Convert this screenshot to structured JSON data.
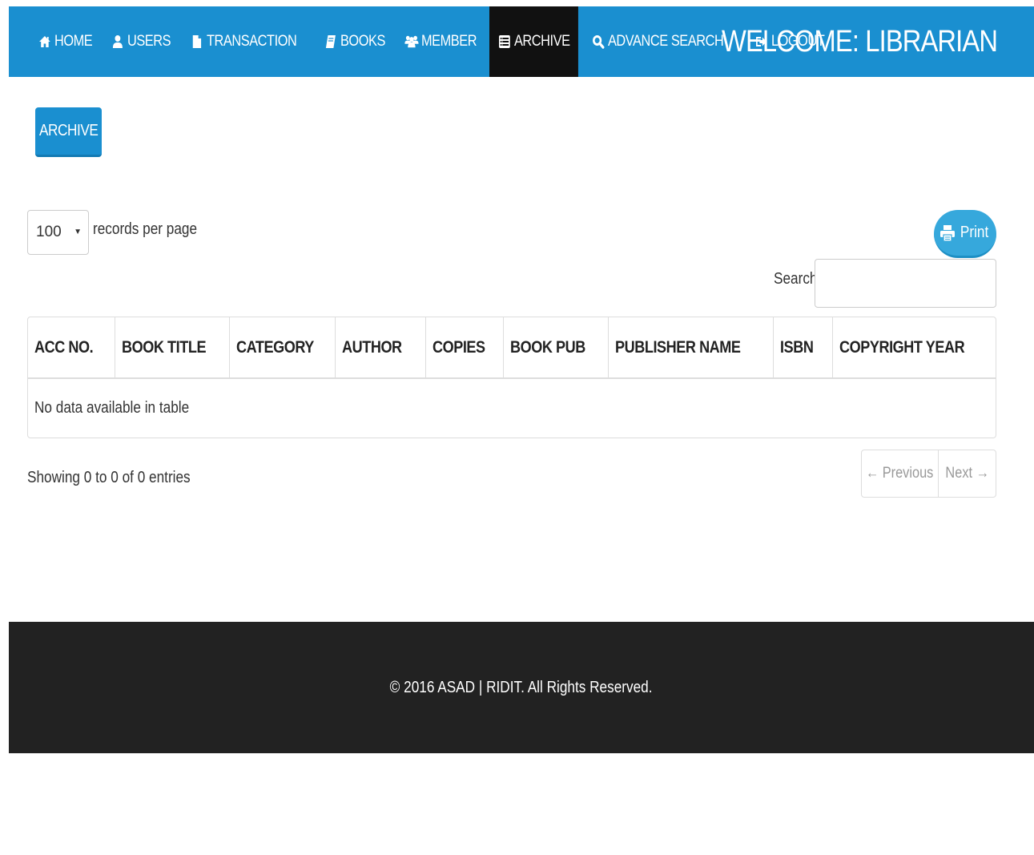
{
  "nav": {
    "items": [
      {
        "label": "HOME",
        "icon": "home-icon"
      },
      {
        "label": "USERS",
        "icon": "user-icon"
      },
      {
        "label": "TRANSACTION",
        "icon": "file-icon"
      },
      {
        "label": "BOOKS",
        "icon": "book-icon"
      },
      {
        "label": "MEMBER",
        "icon": "users-icon"
      },
      {
        "label": "ARCHIVE",
        "icon": "list-icon"
      },
      {
        "label": "ADVANCE SEARCH",
        "icon": "search-icon"
      },
      {
        "label": "LOGOUT",
        "icon": "logout-icon"
      }
    ],
    "active": "ARCHIVE",
    "welcome": "WELCOME: LIBRARIAN"
  },
  "page": {
    "archive_button": "ARCHIVE"
  },
  "controls": {
    "length_value": "100",
    "length_label": "records per page",
    "print_label": "Print",
    "search_label": "Search:",
    "search_value": ""
  },
  "table": {
    "columns": [
      "ACC NO.",
      "BOOK TITLE",
      "CATEGORY",
      "AUTHOR",
      "COPIES",
      "BOOK PUB",
      "PUBLISHER NAME",
      "ISBN",
      "COPYRIGHT YEAR"
    ],
    "empty_message": "No data available in table"
  },
  "footer_info": {
    "showing": "Showing 0 to 0 of 0 entries",
    "previous": "← Previous",
    "next": "Next →"
  },
  "footer": {
    "copyright": "© 2016 ASAD | RIDIT. All Rights Reserved."
  },
  "colors": {
    "primary": "#1a8fd0",
    "active_nav": "#111111",
    "footer_bg": "#222222",
    "print_button": "#36a8dc"
  }
}
